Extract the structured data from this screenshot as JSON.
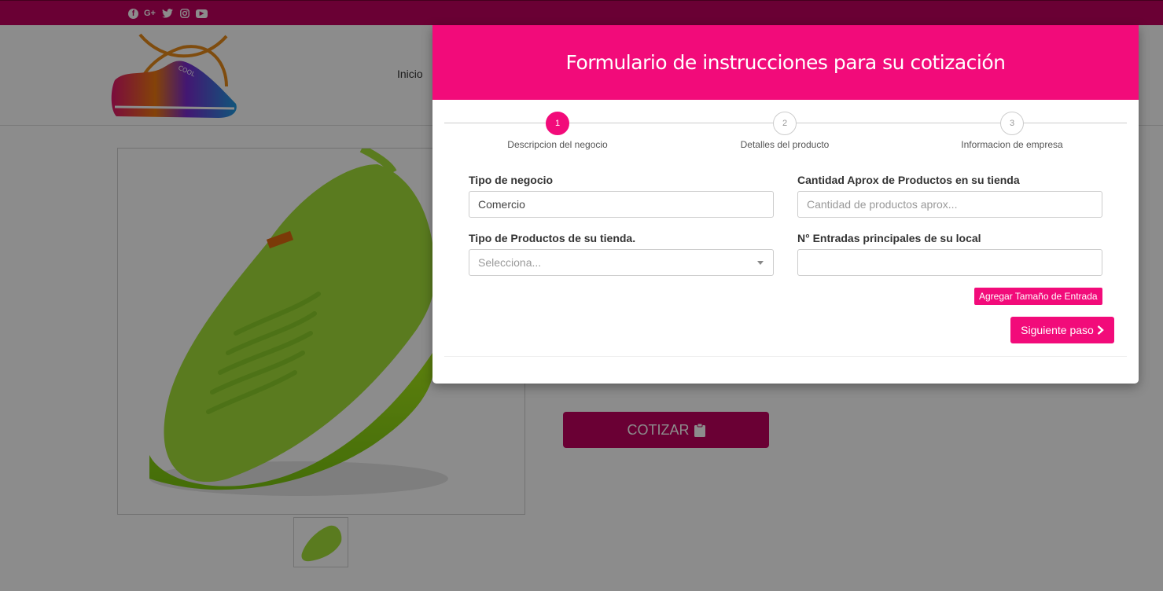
{
  "social": {
    "facebook": "facebook-icon",
    "googleplus": "google-plus-icon",
    "twitter": "twitter-icon",
    "instagram": "instagram-icon",
    "youtube": "youtube-icon",
    "googleplus_text": "G+"
  },
  "nav": {
    "inicio": "Inicio"
  },
  "product": {
    "cotizar_label": "COTIZAR"
  },
  "modal": {
    "title": "Formulario de instrucciones para su cotización",
    "steps": [
      {
        "number": "1",
        "label": "Descripcion del negocio"
      },
      {
        "number": "2",
        "label": "Detalles del producto"
      },
      {
        "number": "3",
        "label": "Informacion de empresa"
      }
    ],
    "fields": {
      "tipo_negocio": {
        "label": "Tipo de negocio",
        "value": "Comercio"
      },
      "cantidad": {
        "label": "Cantidad Aprox de Productos en su tienda",
        "placeholder": "Cantidad de productos aprox..."
      },
      "tipo_productos": {
        "label": "Tipo de Productos de su tienda.",
        "placeholder": "Selecciona..."
      },
      "entradas": {
        "label": "N° Entradas principales de su local",
        "value": ""
      }
    },
    "add_entry_label": "Agregar Tamaño de Entrada",
    "next_label": "Siguiente paso"
  },
  "colors": {
    "brand_pink": "#f20b7a",
    "brand_dark": "#c20060"
  }
}
